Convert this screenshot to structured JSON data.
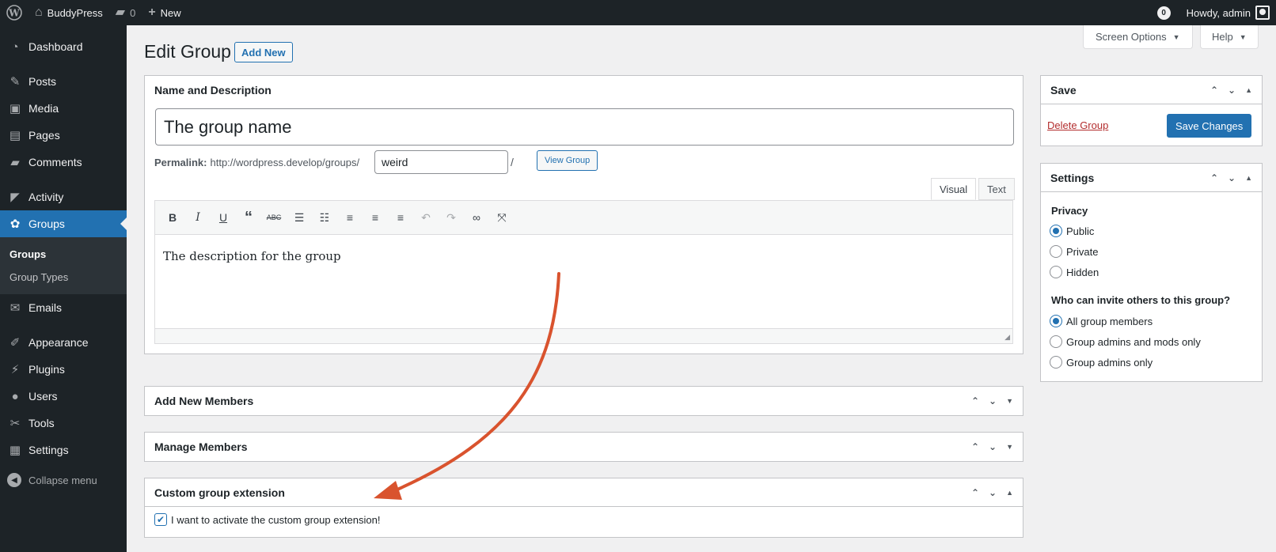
{
  "adminbar": {
    "site_name": "BuddyPress",
    "comments_count": "0",
    "new_label": "New",
    "notif_count": "0",
    "howdy": "Howdy, admin"
  },
  "sidebar": {
    "items": [
      {
        "label": "Dashboard",
        "icon": "dashboard-icon"
      },
      {
        "label": "Posts",
        "icon": "pin-icon"
      },
      {
        "label": "Media",
        "icon": "media-icon"
      },
      {
        "label": "Pages",
        "icon": "pages-icon"
      },
      {
        "label": "Comments",
        "icon": "comment-icon"
      },
      {
        "label": "Activity",
        "icon": "activity-icon"
      },
      {
        "label": "Groups",
        "icon": "groups-icon"
      },
      {
        "label": "Emails",
        "icon": "mail-icon"
      },
      {
        "label": "Appearance",
        "icon": "brush-icon"
      },
      {
        "label": "Plugins",
        "icon": "plug-icon"
      },
      {
        "label": "Users",
        "icon": "user-icon"
      },
      {
        "label": "Tools",
        "icon": "wrench-icon"
      },
      {
        "label": "Settings",
        "icon": "settings-icon"
      }
    ],
    "sub_groups": "Groups",
    "sub_group_types": "Group Types",
    "collapse": "Collapse menu"
  },
  "top": {
    "screen_options": "Screen Options",
    "help": "Help"
  },
  "page": {
    "title": "Edit Group",
    "add_new": "Add New"
  },
  "name_box": {
    "title": "Name and Description",
    "group_name": "The group name",
    "permalink_label": "Permalink:",
    "permalink_url": "http://wordpress.develop/groups/",
    "slug": "weird",
    "slash": "/",
    "view_group": "View Group",
    "tab_visual": "Visual",
    "tab_text": "Text",
    "description": "The description for the group"
  },
  "boxes": {
    "add_members": "Add New Members",
    "manage_members": "Manage Members",
    "custom_ext": "Custom group extension",
    "custom_ext_checkbox": "I want to activate the custom group extension!"
  },
  "save_box": {
    "title": "Save",
    "delete": "Delete Group",
    "save": "Save Changes"
  },
  "settings_box": {
    "title": "Settings",
    "privacy_label": "Privacy",
    "privacy_options": [
      "Public",
      "Private",
      "Hidden"
    ],
    "privacy_selected": "Public",
    "invite_label": "Who can invite others to this group?",
    "invite_options": [
      "All group members",
      "Group admins and mods only",
      "Group admins only"
    ],
    "invite_selected": "All group members"
  },
  "colors": {
    "accent": "#2271b1",
    "annotation_arrow": "#d9532e",
    "danger": "#b32d2e"
  }
}
